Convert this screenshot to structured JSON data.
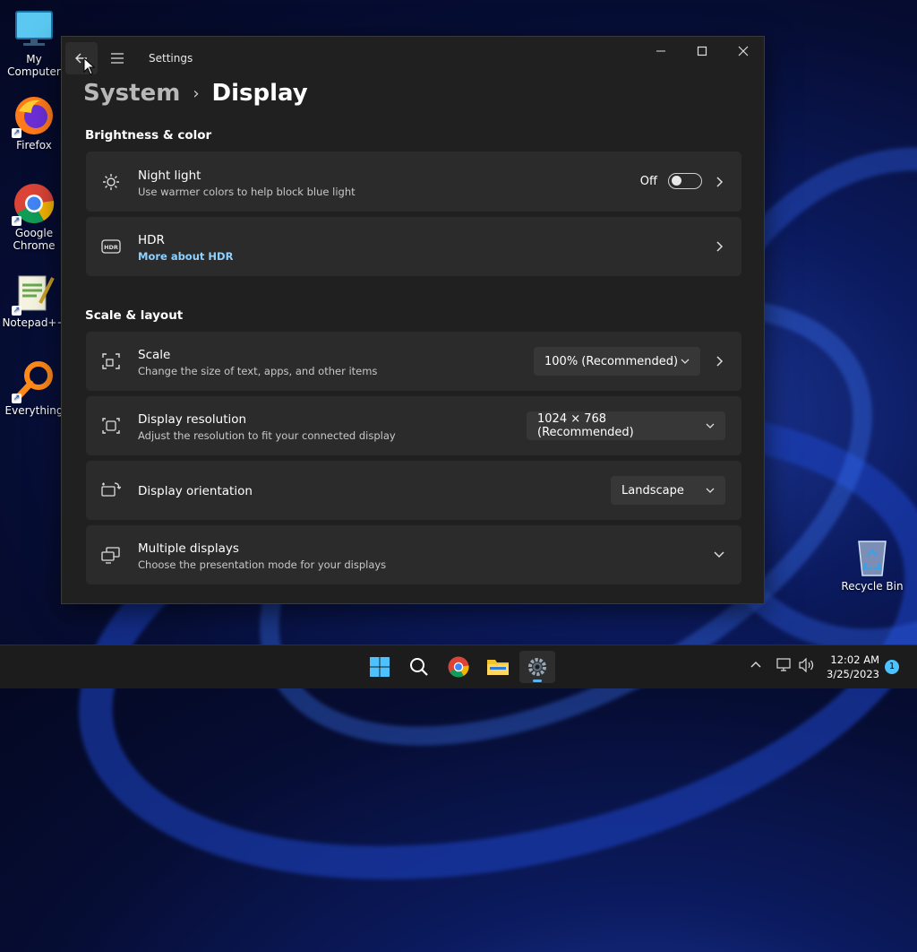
{
  "desktop": {
    "icons": [
      {
        "label": "My Computer",
        "icon": "monitor-icon"
      },
      {
        "label": "Firefox",
        "icon": "firefox-icon"
      },
      {
        "label": "Google Chrome",
        "icon": "chrome-icon"
      },
      {
        "label": "Notepad++",
        "icon": "notepadpp-icon"
      },
      {
        "label": "Everything",
        "icon": "everything-search-icon"
      },
      {
        "label": "Recycle Bin",
        "icon": "recycle-bin-icon"
      }
    ]
  },
  "window": {
    "app_title": "Settings",
    "breadcrumb": {
      "parent": "System",
      "separator": "›",
      "current": "Display"
    },
    "caption": {
      "minimize": "—",
      "maximize": "☐",
      "close": "✕"
    },
    "sections": [
      {
        "title": "Brightness & color"
      },
      {
        "title": "Scale & layout"
      }
    ],
    "night_light": {
      "title": "Night light",
      "subtitle": "Use warmer colors to help block blue light",
      "toggle_state": "Off",
      "icon": "brightness-icon"
    },
    "hdr": {
      "title": "HDR",
      "link": "More about HDR",
      "icon": "hdr-icon"
    },
    "scale": {
      "title": "Scale",
      "subtitle": "Change the size of text, apps, and other items",
      "value": "100% (Recommended)",
      "icon": "scale-icon"
    },
    "resolution": {
      "title": "Display resolution",
      "subtitle": "Adjust the resolution to fit your connected display",
      "value": "1024 × 768 (Recommended)",
      "icon": "resolution-icon"
    },
    "orientation": {
      "title": "Display orientation",
      "value": "Landscape",
      "icon": "orientation-icon"
    },
    "multiple": {
      "title": "Multiple displays",
      "subtitle": "Choose the presentation mode for your displays",
      "icon": "multiple-displays-icon"
    }
  },
  "taskbar": {
    "apps": [
      "start-icon",
      "search-icon",
      "chrome-icon",
      "file-explorer-icon",
      "settings-icon"
    ],
    "active_app": "settings-icon",
    "time": "12:02 AM",
    "date": "3/25/2023",
    "notification_count": "1"
  },
  "colors": {
    "accent": "#4cc2ff",
    "window_bg": "#202020",
    "card_bg": "#2b2b2b",
    "link": "#8fd0ff"
  }
}
